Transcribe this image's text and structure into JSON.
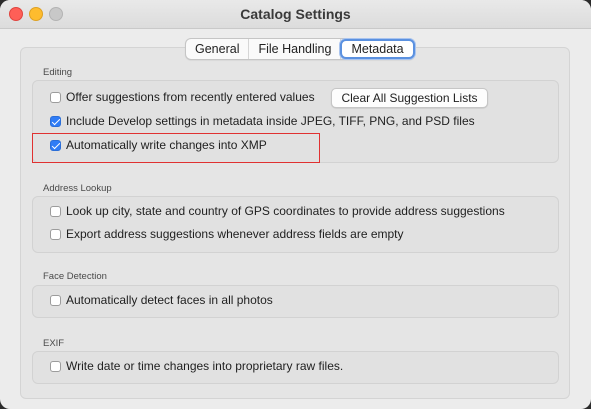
{
  "window": {
    "title": "Catalog Settings"
  },
  "tabs": [
    {
      "label": "General",
      "active": false
    },
    {
      "label": "File Handling",
      "active": false
    },
    {
      "label": "Metadata",
      "active": true
    }
  ],
  "editing": {
    "label": "Editing",
    "offer_suggestions": {
      "label": "Offer suggestions from recently entered values",
      "checked": false
    },
    "clear_button": "Clear All Suggestion Lists",
    "include_develop": {
      "label": "Include Develop settings in metadata inside JPEG, TIFF, PNG, and PSD files",
      "checked": true
    },
    "auto_write_xmp": {
      "label": "Automatically write changes into XMP",
      "checked": true
    }
  },
  "address_lookup": {
    "label": "Address Lookup",
    "gps_lookup": {
      "label": "Look up city, state and country of GPS coordinates to provide address suggestions",
      "checked": false
    },
    "export_suggestions": {
      "label": "Export address suggestions whenever address fields are empty",
      "checked": false
    }
  },
  "face_detection": {
    "label": "Face Detection",
    "auto_detect": {
      "label": "Automatically detect faces in all photos",
      "checked": false
    }
  },
  "exif": {
    "label": "EXIF",
    "write_date": {
      "label": "Write date or time changes into proprietary raw files.",
      "checked": false
    }
  },
  "colors": {
    "accent": "#2f7cf6",
    "highlight": "#e03131"
  }
}
